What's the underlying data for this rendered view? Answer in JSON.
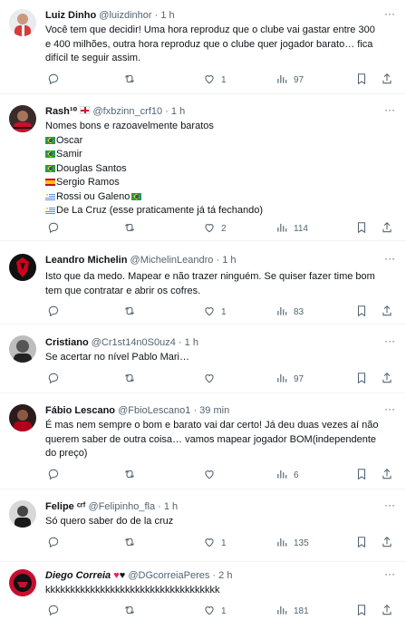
{
  "tweets": [
    {
      "name": "Luiz Dinho",
      "handle": "@luizdinhor",
      "time": "1 h",
      "lines": [
        "Você tem que decidir! Uma hora reproduz que o clube vai gastar entre 300",
        "e 400 milhões, outra hora reproduz que o clube quer jogador barato… fica",
        "difícil te seguir assim."
      ],
      "replies": "",
      "retweets": "",
      "likes": "1",
      "views": "97"
    },
    {
      "name": "Rash¹⁰",
      "handle": "@fxbzinn_crf10",
      "time": "1 h",
      "lines": [
        "Nomes bons e razoavelmente baratos",
        "Oscar",
        "Samir",
        "Douglas Santos",
        "Sergio Ramos",
        "Rossi ou Galeno",
        "De La Cruz (esse praticamente já tá fechando)"
      ],
      "replies": "",
      "retweets": "",
      "likes": "2",
      "views": "114"
    },
    {
      "name": "Leandro Michelin",
      "handle": "@MichelinLeandro",
      "time": "1 h",
      "lines": [
        "Isto que da medo. Mapear e não trazer ninguém. Se quiser fazer time bom",
        "tem que contratar e abrir os cofres."
      ],
      "replies": "",
      "retweets": "",
      "likes": "1",
      "views": "83"
    },
    {
      "name": "Cristiano",
      "handle": "@Cr1st14n0S0uz4",
      "time": "1 h",
      "lines": [
        "Se acertar no nível Pablo Mari…"
      ],
      "replies": "",
      "retweets": "",
      "likes": "",
      "views": "97"
    },
    {
      "name": "Fábio Lescano",
      "handle": "@FbioLescano1",
      "time": "39 min",
      "lines": [
        "É mas nem sempre o bom e barato vai dar certo! Já deu duas vezes aí não",
        "querem saber de outra coisa… vamos mapear jogador BOM(independente",
        "do preço)"
      ],
      "replies": "",
      "retweets": "",
      "likes": "",
      "views": "6"
    },
    {
      "name": "Felipe ᶜʳᶠ",
      "handle": "@Felipinho_fla",
      "time": "1 h",
      "lines": [
        "Só quero saber do de la cruz"
      ],
      "replies": "",
      "retweets": "",
      "likes": "1",
      "views": "135"
    },
    {
      "name": "Diego Correia",
      "handle": "@DGcorreiaPeres",
      "time": "2 h",
      "lines": [
        "kkkkkkkkkkkkkkkkkkkkkkkkkkkkkkkkkkk"
      ],
      "replies": "",
      "retweets": "",
      "likes": "1",
      "views": "181"
    }
  ],
  "colors": {
    "text": "#0f1419",
    "muted": "#536471",
    "divider": "#eff3f4"
  },
  "icons": [
    "reply-icon",
    "retweet-icon",
    "like-icon",
    "views-icon",
    "bookmark-icon",
    "share-icon",
    "more-icon"
  ]
}
